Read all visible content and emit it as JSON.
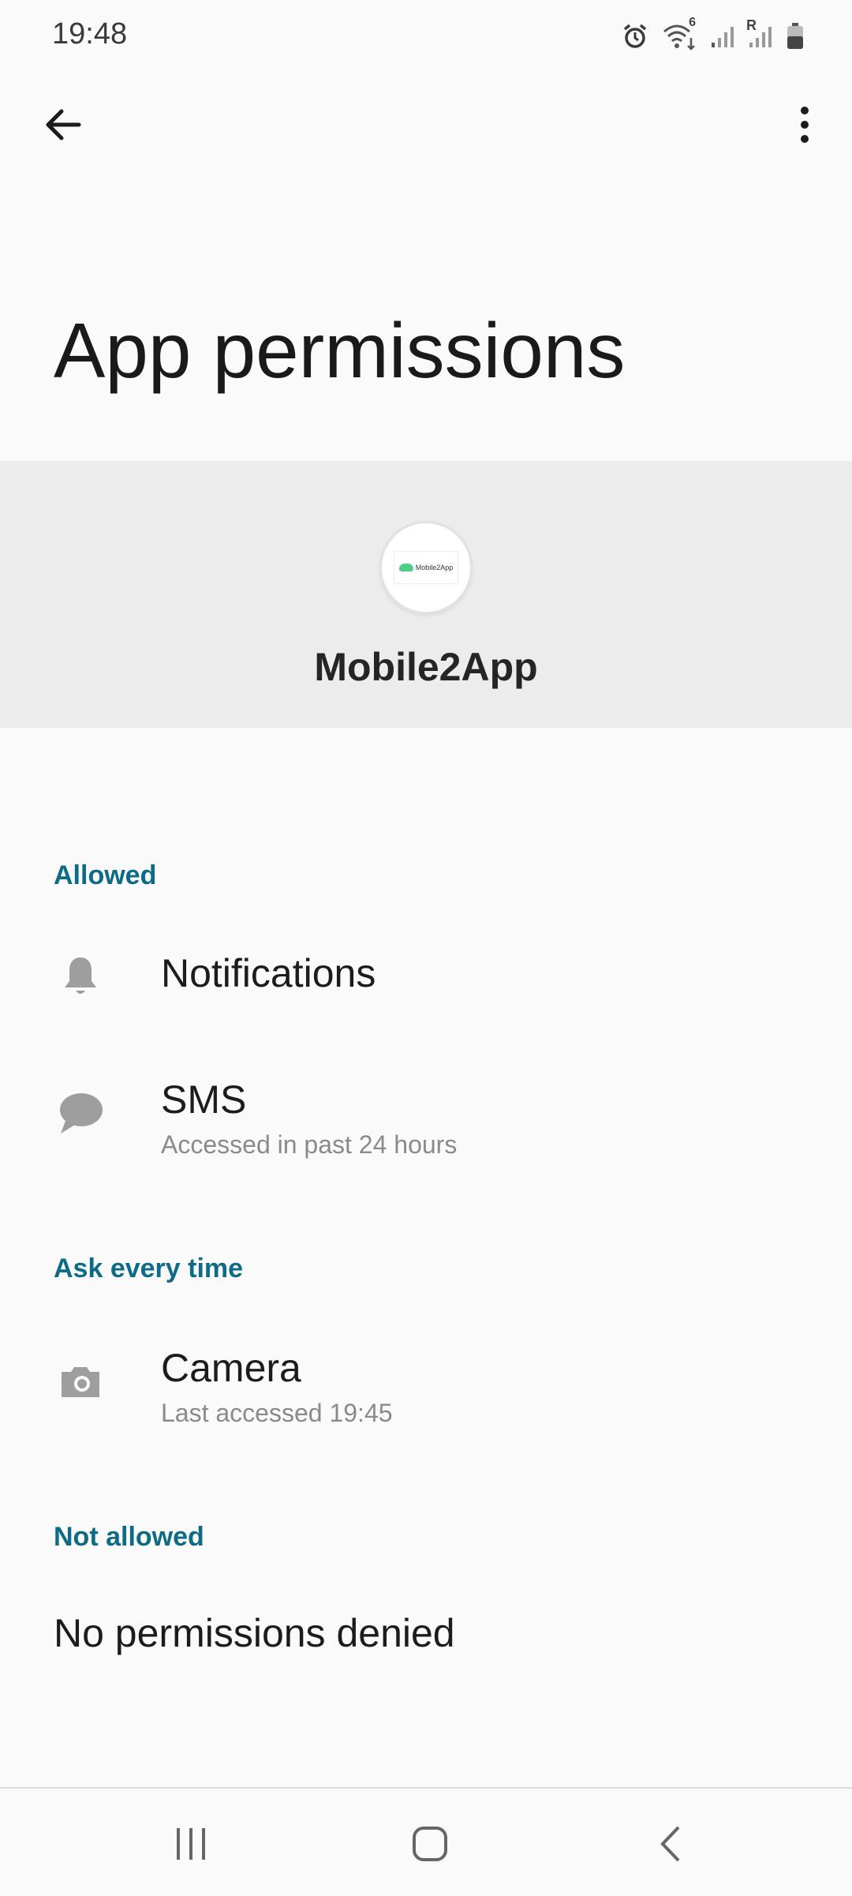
{
  "status_bar": {
    "time": "19:48",
    "icons": [
      "alarm-icon",
      "wifi-icon",
      "signal-icon",
      "roaming-signal-icon",
      "battery-icon"
    ],
    "wifi_badge": "6",
    "roaming_badge": "R"
  },
  "app_bar": {
    "back_icon": "arrow-left-icon",
    "more_icon": "more-vertical-icon"
  },
  "page": {
    "title": "App permissions"
  },
  "app": {
    "name": "Mobile2App",
    "icon_text": "Mobile2App"
  },
  "sections": {
    "allowed": {
      "label": "Allowed",
      "items": [
        {
          "title": "Notifications",
          "subtitle": "",
          "icon": "bell-icon"
        },
        {
          "title": "SMS",
          "subtitle": "Accessed in past 24 hours",
          "icon": "message-icon"
        }
      ]
    },
    "ask": {
      "label": "Ask every time",
      "items": [
        {
          "title": "Camera",
          "subtitle": "Last accessed 19:45",
          "icon": "camera-icon"
        }
      ]
    },
    "not_allowed": {
      "label": "Not allowed",
      "empty_text": "No permissions denied"
    }
  },
  "nav_bar": {
    "recents_icon": "recents-icon",
    "home_icon": "home-icon",
    "back_icon": "back-chevron-icon"
  },
  "colors": {
    "background": "#fafafa",
    "header_band": "#ececec",
    "section_accent": "#0d6b86",
    "secondary_text": "#8a8a8a",
    "icon_gray": "#9e9e9e"
  }
}
